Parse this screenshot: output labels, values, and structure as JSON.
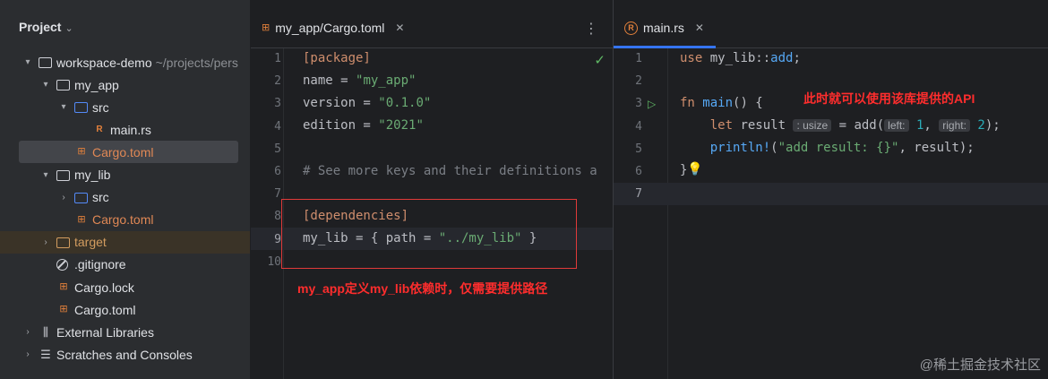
{
  "project": {
    "title": "Project",
    "tree": [
      {
        "label": "workspace-demo",
        "suffix": "~/projects/pers",
        "type": "folder",
        "arrow": "▾",
        "indent": 0
      },
      {
        "label": "my_app",
        "type": "folder",
        "arrow": "▾",
        "indent": 1
      },
      {
        "label": "src",
        "type": "folder-blue",
        "arrow": "▾",
        "indent": 2
      },
      {
        "label": "main.rs",
        "type": "rust",
        "indent": 3
      },
      {
        "label": "Cargo.toml",
        "type": "cargo",
        "indent": 2,
        "selected": true
      },
      {
        "label": "my_lib",
        "type": "folder",
        "arrow": "▾",
        "indent": 1
      },
      {
        "label": "src",
        "type": "folder-blue",
        "arrow": "›",
        "indent": 2
      },
      {
        "label": "Cargo.toml",
        "type": "cargo",
        "indent": 2
      },
      {
        "label": "target",
        "type": "folder-orange",
        "arrow": "›",
        "indent": 1,
        "highlight": true
      },
      {
        "label": ".gitignore",
        "type": "gitignore",
        "indent": 1
      },
      {
        "label": "Cargo.lock",
        "type": "cargo",
        "indent": 1
      },
      {
        "label": "Cargo.toml",
        "type": "cargo",
        "indent": 1
      },
      {
        "label": "External Libraries",
        "type": "libs",
        "arrow": "›",
        "indent": 0
      },
      {
        "label": "Scratches and Consoles",
        "type": "scratch",
        "arrow": "›",
        "indent": 0
      }
    ]
  },
  "editor_left": {
    "tab_label": "my_app/Cargo.toml",
    "line_numbers": [
      "1",
      "2",
      "3",
      "4",
      "5",
      "6",
      "7",
      "8",
      "9",
      "10"
    ],
    "lines": {
      "l1": "[package]",
      "l2_key": "name = ",
      "l2_val": "\"my_app\"",
      "l3_key": "version = ",
      "l3_val": "\"0.1.0\"",
      "l4_key": "edition = ",
      "l4_val": "\"2021\"",
      "l6": "# See more keys and their definitions a",
      "l8": "[dependencies]",
      "l9_a": "my_lib = { path = ",
      "l9_val": "\"../my_lib\"",
      "l9_b": " }"
    },
    "annotation": "my_app定义my_lib依赖时，仅需要提供路径"
  },
  "editor_right": {
    "tab_label": "main.rs",
    "line_numbers": [
      "1",
      "2",
      "3",
      "4",
      "5",
      "6",
      "7"
    ],
    "lines": {
      "l1_kw": "use",
      "l1_rest": " my_lib::",
      "l1_fn": "add",
      "l1_end": ";",
      "l3_kw": "fn",
      "l3_fn": " main",
      "l3_end": "() {",
      "l4_kw": "let",
      "l4_var": " result",
      "l4_hint": ": usize",
      "l4_mid": " = add(",
      "l4_h1": "left:",
      "l4_n1": "1",
      "l4_comma": ", ",
      "l4_h2": "right:",
      "l4_n2": "2",
      "l4_end": ");",
      "l5_mac": "println!",
      "l5_open": "(",
      "l5_str": "\"add result: {}\"",
      "l5_end": ", result);",
      "l6": "}"
    },
    "annotation": "此时就可以使用该库提供的API"
  },
  "watermark": "@稀土掘金技术社区"
}
